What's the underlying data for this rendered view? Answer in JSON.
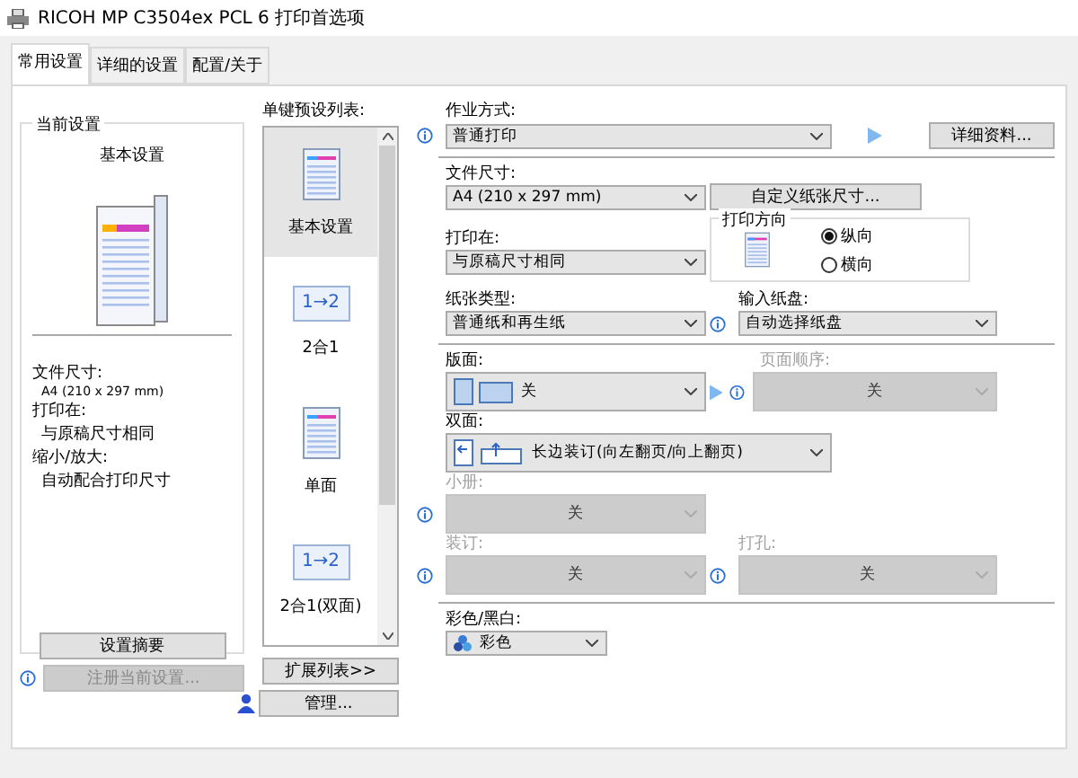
{
  "window": {
    "title": "RICOH MP C3504ex PCL 6 打印首选项"
  },
  "tabs": [
    {
      "label": "常用设置",
      "selected": true
    },
    {
      "label": "详细的设置",
      "selected": false
    },
    {
      "label": "配置/关于",
      "selected": false
    }
  ],
  "current_settings": {
    "heading": "当前设置",
    "preset_name": "基本设置",
    "summary": [
      {
        "label": "文件尺寸:",
        "value": "A4 (210 x 297 mm)"
      },
      {
        "label": "打印在:",
        "value": "与原稿尺寸相同"
      },
      {
        "label": "缩小/放大:",
        "value": "自动配合打印尺寸"
      }
    ],
    "summary_button": "设置摘要",
    "register_button": {
      "label": "注册当前设置...",
      "disabled": true
    }
  },
  "presets": {
    "label": "单键预设列表:",
    "items": [
      {
        "label": "基本设置",
        "kind": "page",
        "selected": true
      },
      {
        "label": "2合1",
        "kind": "combine",
        "icon_text": "1→2",
        "selected": false
      },
      {
        "label": "单面",
        "kind": "page",
        "selected": false
      },
      {
        "label": "2合1(双面)",
        "kind": "combine",
        "icon_text": "1→2",
        "selected": false
      }
    ],
    "expand_button": "扩展列表>>",
    "manage_button": "管理..."
  },
  "form": {
    "job_type": {
      "label": "作业方式:",
      "value": "普通打印",
      "details_button": "详细资料..."
    },
    "paper_size": {
      "label": "文件尺寸:",
      "value": "A4 (210 x 297 mm)"
    },
    "custom_size_button": "自定义纸张尺寸...",
    "print_on": {
      "label": "打印在:",
      "value": "与原稿尺寸相同"
    },
    "orientation": {
      "label": "打印方向",
      "options": [
        {
          "label": "纵向",
          "selected": true
        },
        {
          "label": "横向",
          "selected": false
        }
      ]
    },
    "paper_type": {
      "label": "纸张类型:",
      "value": "普通纸和再生纸"
    },
    "input_tray": {
      "label": "输入纸盘:",
      "value": "自动选择纸盘"
    },
    "layout": {
      "label": "版面:",
      "value": "关"
    },
    "page_order": {
      "label": "页面顺序:",
      "value": "关",
      "disabled": true
    },
    "duplex": {
      "label": "双面:",
      "value": "长边装订(向左翻页/向上翻页)"
    },
    "booklet": {
      "label": "小册:",
      "value": "关",
      "disabled": true
    },
    "staple": {
      "label": "装订:",
      "value": "关",
      "disabled": true
    },
    "punch": {
      "label": "打孔:",
      "value": "关",
      "disabled": true
    },
    "color_mode": {
      "label": "彩色/黑白:",
      "value": "彩色"
    }
  }
}
